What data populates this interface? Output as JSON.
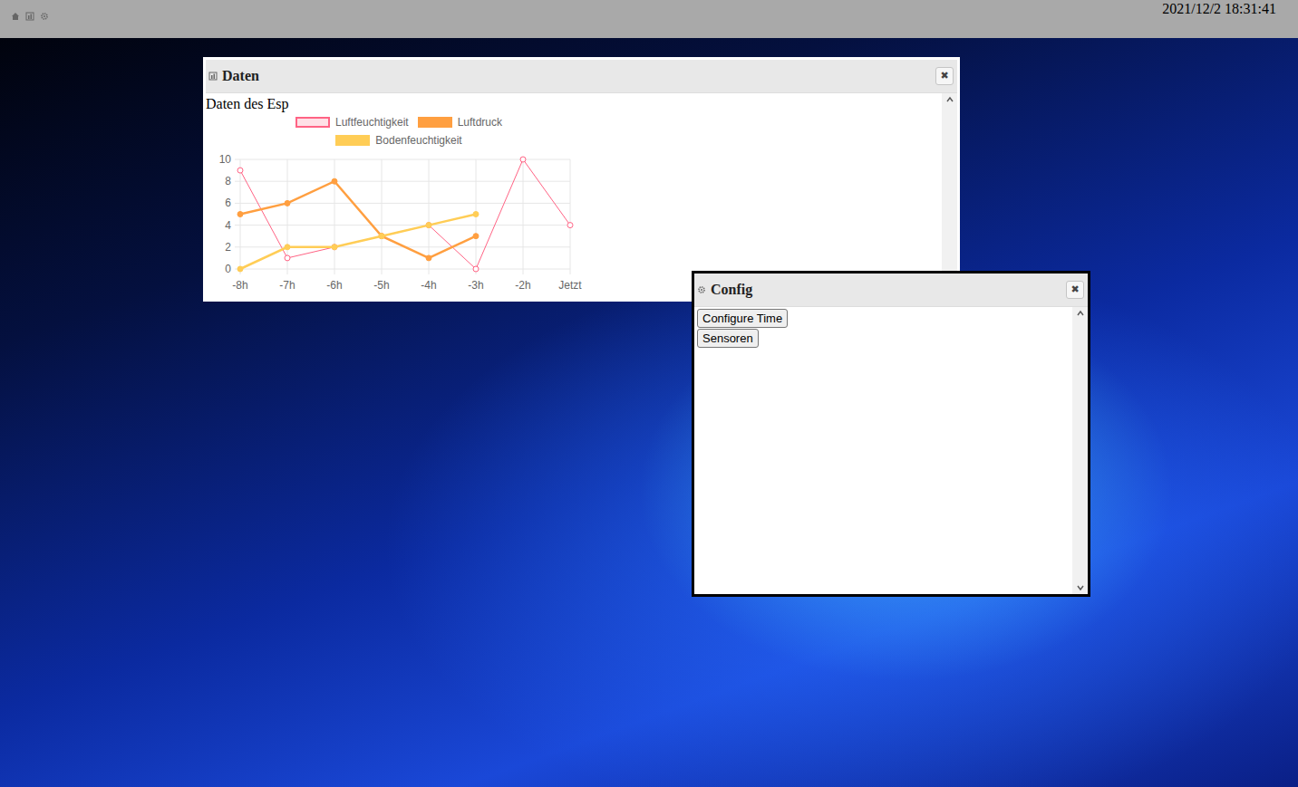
{
  "topbar": {
    "clock": "2021/12/2 18:31:41"
  },
  "daten_window": {
    "title": "Daten",
    "close": "✖",
    "heading": "Daten des Esp",
    "chart": {
      "y_ticks": [
        "0",
        "2",
        "4",
        "6",
        "8",
        "10"
      ],
      "x_labels": [
        "-8h",
        "-7h",
        "-6h",
        "-5h",
        "-4h",
        "-3h",
        "-2h",
        "Jetzt"
      ],
      "series": [
        {
          "name": "Luftfeuchtigkeit",
          "color": "#ff6384",
          "filled": false,
          "values": [
            9,
            1,
            2,
            3,
            4,
            0,
            10,
            4
          ]
        },
        {
          "name": "Luftdruck",
          "color": "#ff9f40",
          "filled": true,
          "values": [
            5,
            6,
            8,
            3,
            1,
            3
          ]
        },
        {
          "name": "Bodenfeuchtigkeit",
          "color": "#ffcd56",
          "filled": true,
          "values": [
            0,
            2,
            2,
            3,
            4,
            5
          ]
        }
      ]
    }
  },
  "config_window": {
    "title": "Config",
    "close": "✖",
    "buttons": [
      "Configure Time",
      "Sensoren"
    ]
  }
}
